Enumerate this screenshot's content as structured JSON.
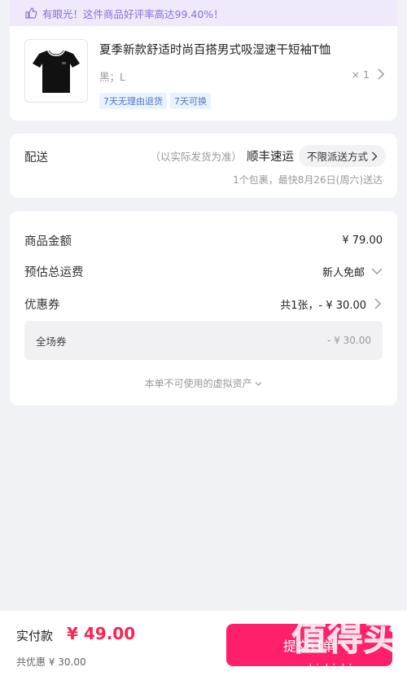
{
  "praise_banner": {
    "text": "有眼光！这件商品好评率高达99.40%！"
  },
  "product": {
    "title": "夏季新款舒适时尚百搭男式吸湿速干短袖T恤",
    "spec": "黑；L",
    "quantity": "× 1",
    "tags": [
      "7天无理由退货",
      "7天可换"
    ]
  },
  "delivery": {
    "label": "配送",
    "note": "（以实际发货为准）",
    "carrier": "顺丰速运",
    "method": "不限派送方式",
    "eta": "1个包裹，最快8月26日(周六)送达"
  },
  "amounts": {
    "goods_label": "商品金额",
    "goods_value": "¥ 79.00",
    "shipping_label": "预估总运费",
    "shipping_value": "新人免邮",
    "coupon_label": "优惠券",
    "coupon_value": "共1张，- ¥ 30.00",
    "coupon_item_name": "全场券",
    "coupon_item_value": "- ¥ 30.00",
    "assets_note": "本单不可使用的虚拟资产"
  },
  "bottom": {
    "paid_label": "实付款",
    "paid_amount": "¥ 49.00",
    "discount_total": "共优惠 ¥ 30.00",
    "submit_label": "提交订单"
  },
  "watermark": {
    "brand": "值得买",
    "url": "zhizhizhi.com"
  },
  "colors": {
    "accent": "#ff1f6b",
    "banner_bg": "#efe9fb",
    "banner_text": "#8b6fd6",
    "tag_text": "#4c78c9",
    "page_bg": "#f1f2f6"
  },
  "icons": [
    "thumbs-up-icon",
    "chevron-right-icon",
    "chevron-down-icon",
    "tshirt-icon"
  ]
}
